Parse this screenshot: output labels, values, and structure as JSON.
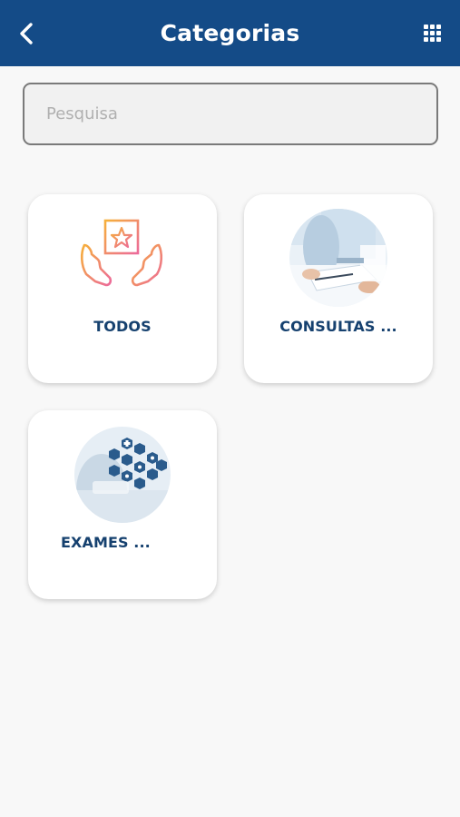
{
  "header": {
    "title": "Categorias",
    "back_icon": "chevron-left-icon",
    "menu_icon": "grid-icon",
    "color": "#144b87"
  },
  "search": {
    "placeholder": "Pesquisa",
    "value": ""
  },
  "categories": [
    {
      "label": "TODOS",
      "icon": "hands-star-icon"
    },
    {
      "label": "CONSULTAS ...",
      "icon": "consultation-photo"
    },
    {
      "label": "EXAMES ...",
      "icon": "medical-exams-photo"
    }
  ],
  "colors": {
    "label": "#16416f",
    "background": "#f8f8f8",
    "card": "#ffffff"
  }
}
